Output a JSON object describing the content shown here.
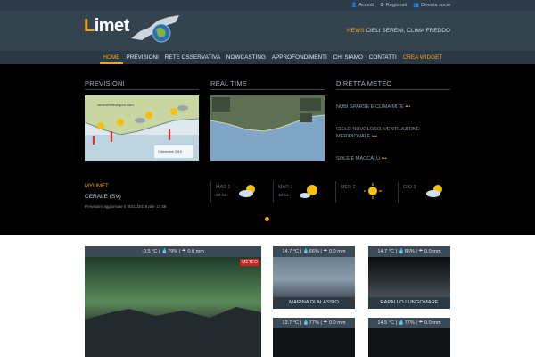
{
  "topbar": {
    "accedi": "Accedi",
    "registrati": "Registrati",
    "diventa_socio": "Diventa socio"
  },
  "header": {
    "logo_initial": "L",
    "logo_rest": "imet",
    "news_tag": "NEWS",
    "news_text": "CIELI SERENI, CLIMA FREDDO"
  },
  "nav": {
    "items": [
      "HOME",
      "PREVISIONI",
      "RETE OSSERVATIVA",
      "NOWCASTING",
      "APPROFONDIMENTI",
      "CHI SIAMO",
      "CONTATTI",
      "CREA WIDGET"
    ]
  },
  "hero": {
    "previsioni_title": "PREVISIONI",
    "realtime_title": "REAL TIME",
    "diretta_title": "DIRETTA METEO",
    "map1_site": "centrometeoligure.com",
    "map1_date": "1 dicembre 2015",
    "diretta": [
      {
        "text": "NUBI SPARSE E CLIMA MITE",
        "dots": "•••"
      },
      {
        "text": "CIELO NUVOLOSO, VENTILAZIONE MERIDIONALE",
        "dots": "•••"
      },
      {
        "text": "SOLE E MACCALU",
        "dots": "•••"
      }
    ],
    "mylimet": "MYLIMET",
    "cerale": "CERALE (SV)",
    "updated": "Previsioni aggiornate il 30/11/2015 alle 17:49",
    "forecasts": [
      {
        "day": "MAR 1",
        "temp": "10 12",
        "icon": "partly-cloudy-icon"
      },
      {
        "day": "MAR 1",
        "temp": "10 11",
        "icon": "sun-cloud-icon"
      },
      {
        "day": "MER 2",
        "temp": "",
        "icon": "sun-icon"
      },
      {
        "day": "GIO 3",
        "temp": "",
        "icon": "partly-cloudy-icon"
      }
    ]
  },
  "webcams": [
    {
      "stats": "-0.5 °C | 💧79% | ☂ 0.0 mm",
      "caption": "",
      "badge": "METEO"
    },
    {
      "stats": "14.7 °C | 💧66% | ☂ 0.0 mm",
      "caption": "MARINA DI ALASSIO"
    },
    {
      "stats": "14.7 °C | 💧66% | ☂ 0.0 mm",
      "caption": "RAPALLO LUNGOMARE"
    },
    {
      "stats": "13.7 °C | 💧77% | ☂ 0.0 mm",
      "caption": ""
    },
    {
      "stats": "14.5 °C | 💧77% | ☂ 0.0 mm",
      "caption": ""
    }
  ],
  "colors": {
    "accent": "#f4a21a",
    "header": "#33444f",
    "nav": "#2a3843"
  }
}
